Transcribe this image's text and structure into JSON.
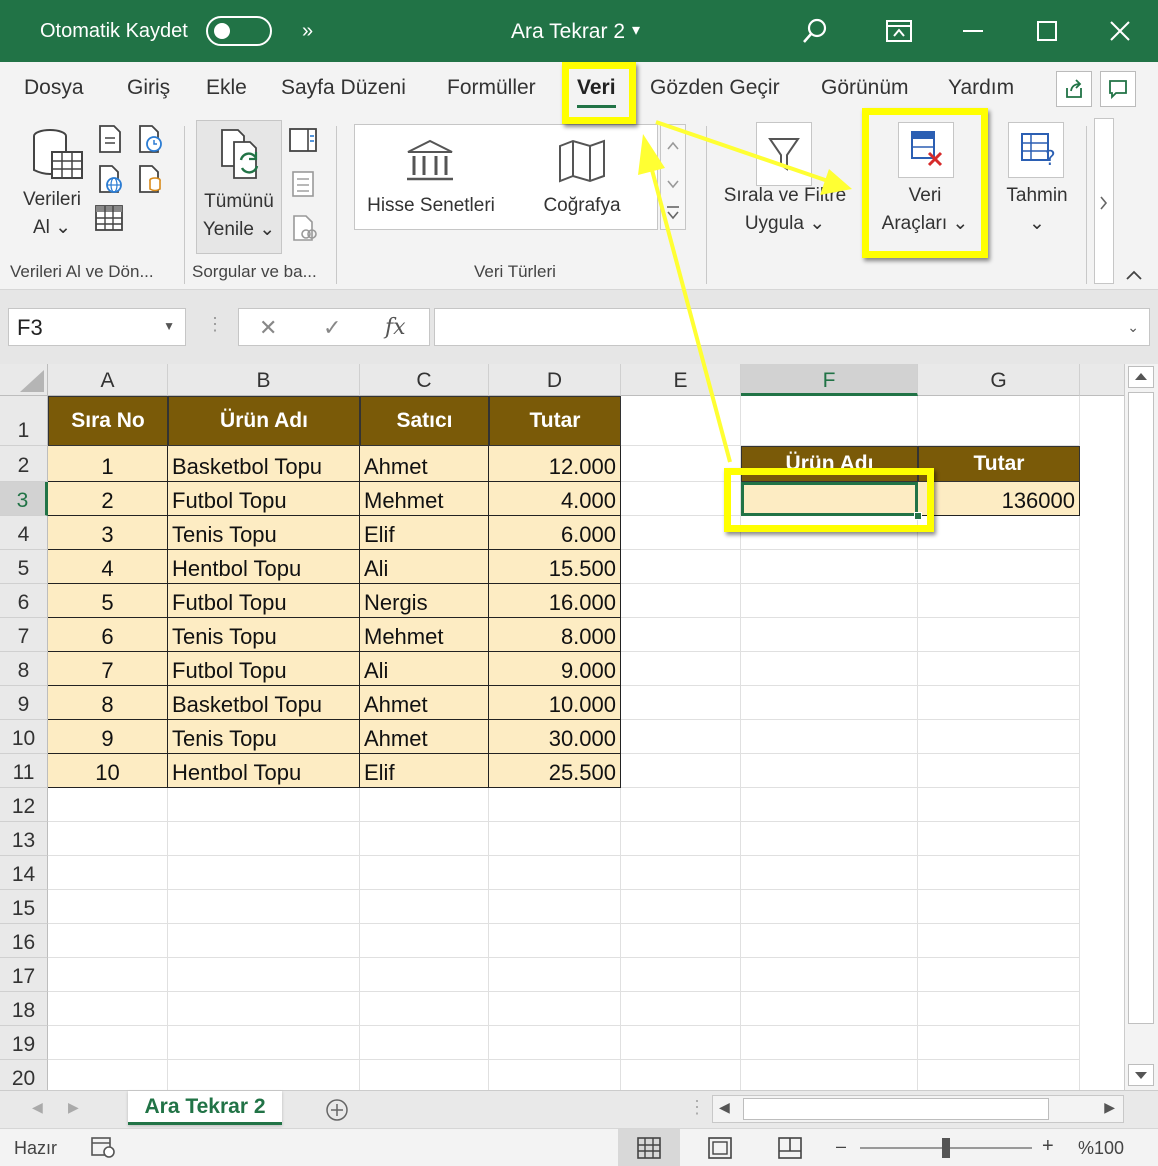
{
  "titlebar": {
    "autosave_label": "Otomatik Kaydet",
    "more": "»",
    "doc_title": "Ara Tekrar 2",
    "title_caret": "▾"
  },
  "menu": {
    "tabs": [
      "Dosya",
      "Giriş",
      "Ekle",
      "Sayfa Düzeni",
      "Formüller",
      "Veri",
      "Gözden Geçir",
      "Görünüm",
      "Yardım"
    ],
    "active": "Veri"
  },
  "ribbon": {
    "verileri_al_line1": "Verileri",
    "verileri_al_line2": "Al ⌄",
    "tumunu_line1": "Tümünü",
    "tumunu_line2": "Yenile ⌄",
    "hisse": "Hisse Senetleri",
    "cografya": "Coğrafya",
    "sirala_line1": "Sırala ve Filtre",
    "sirala_line2": "Uygula ⌄",
    "veri_araclari_line1": "Veri",
    "veri_araclari_line2": "Araçları ⌄",
    "tahmin_line1": "Tahmin",
    "tahmin_line2": "⌄",
    "group_veri_al": "Verileri Al ve Dön...",
    "group_sorgular": "Sorgular ve ba...",
    "group_veri_turleri": "Veri Türleri"
  },
  "formula_bar": {
    "name_box": "F3",
    "cancel": "✕",
    "confirm": "✓",
    "fx": "fx",
    "content": ""
  },
  "grid": {
    "columns": [
      "A",
      "B",
      "C",
      "D",
      "E",
      "F",
      "G"
    ],
    "rows": [
      "1",
      "2",
      "3",
      "4",
      "5",
      "6",
      "7",
      "8",
      "9",
      "10",
      "11",
      "12",
      "13",
      "14",
      "15",
      "16",
      "17",
      "18",
      "19",
      "20"
    ],
    "table_headers": [
      "Sıra No",
      "Ürün Adı",
      "Satıcı",
      "Tutar"
    ],
    "table_rows": [
      [
        "1",
        "Basketbol Topu",
        "Ahmet",
        "12.000"
      ],
      [
        "2",
        "Futbol Topu",
        "Mehmet",
        "4.000"
      ],
      [
        "3",
        "Tenis Topu",
        "Elif",
        "6.000"
      ],
      [
        "4",
        "Hentbol Topu",
        "Ali",
        "15.500"
      ],
      [
        "5",
        "Futbol Topu",
        "Nergis",
        "16.000"
      ],
      [
        "6",
        "Tenis Topu",
        "Mehmet",
        "8.000"
      ],
      [
        "7",
        "Futbol Topu",
        "Ali",
        "9.000"
      ],
      [
        "8",
        "Basketbol Topu",
        "Ahmet",
        "10.000"
      ],
      [
        "9",
        "Tenis Topu",
        "Ahmet",
        "30.000"
      ],
      [
        "10",
        "Hentbol Topu",
        "Elif",
        "25.500"
      ]
    ],
    "criteria_headers": [
      "Ürün Adı",
      "Tutar"
    ],
    "criteria_values": [
      "",
      "136000"
    ],
    "selected_cell": "F3"
  },
  "sheets": {
    "tabs": [
      "Ara Tekrar 2"
    ],
    "add": "+"
  },
  "status": {
    "ready": "Hazır",
    "zoom": "%100",
    "zoom_minus": "–",
    "zoom_plus": "+",
    "zoom_level": 1.0
  },
  "colors": {
    "excel_green": "#217346",
    "header_brown": "#7a5a08",
    "data_fill": "#fdecc3",
    "highlight_yellow": "#ffff00"
  }
}
